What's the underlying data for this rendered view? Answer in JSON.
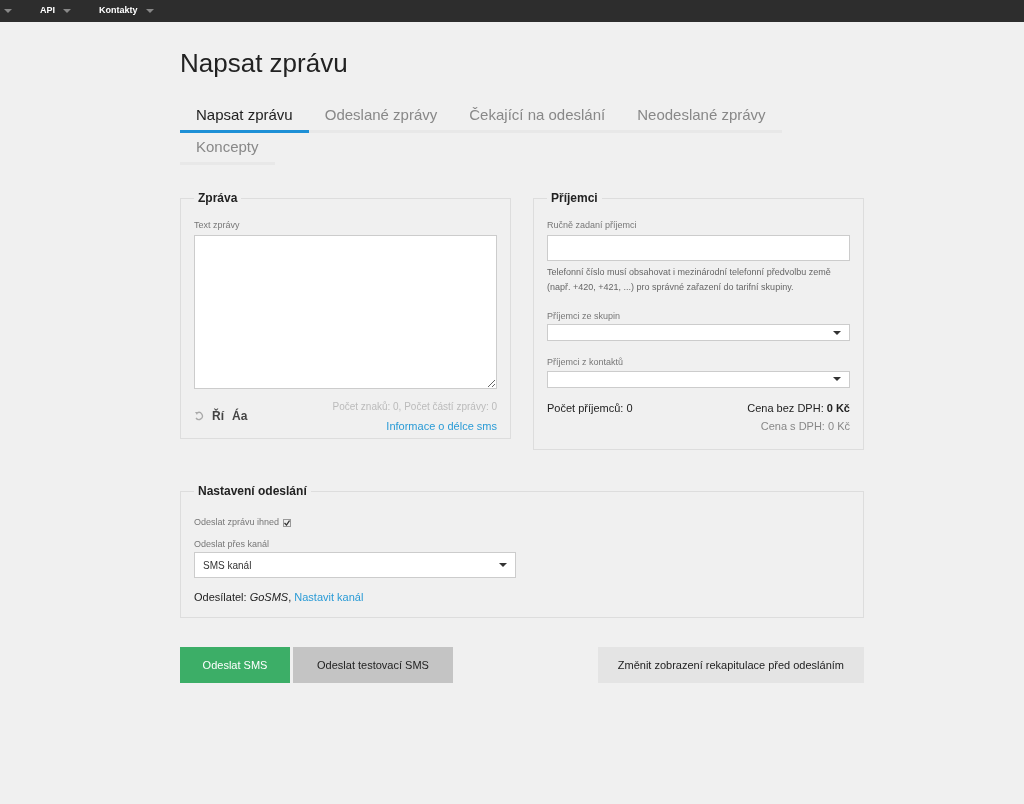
{
  "navbar": {
    "items": [
      {
        "label": "API"
      },
      {
        "label": "Kontakty"
      }
    ]
  },
  "page_title": "Napsat zprávu",
  "tabs": [
    {
      "label": "Napsat zprávu",
      "selected": true
    },
    {
      "label": "Odeslané zprávy",
      "selected": false
    },
    {
      "label": "Čekající na odeslání",
      "selected": false
    },
    {
      "label": "Neodeslané zprávy",
      "selected": false
    },
    {
      "label": "Koncepty",
      "selected": false
    }
  ],
  "message": {
    "legend": "Zpráva",
    "label": "Text zprávy",
    "toolbar": [
      "Ří",
      "Áa"
    ],
    "counter": "Počet znaků: 0, Počet částí zprávy: 0",
    "info_link": "Informace o délce sms"
  },
  "recipients": {
    "legend": "Příjemci",
    "manual_label": "Ručně zadaní příjemci",
    "hint": "Telefonní číslo musí obsahovat i mezinárodní telefonní předvolbu země (např. +420, +421, ...) pro správné zařazení do tarifní skupiny.",
    "groups_label": "Příjemci ze skupin",
    "contacts_label": "Příjemci z kontaktů",
    "count": "Počet příjemců: 0",
    "price_without_vat": "Cena bez DPH: **0 Kč**",
    "price_with_vat": "Cena s DPH: 0 Kč"
  },
  "settings": {
    "legend": "Nastavení odeslání",
    "send_now_label": "Odeslat zprávu ihned",
    "send_now_checked": true,
    "channel_label": "Odeslat přes kanál",
    "channel_value": "SMS kanál",
    "sender_prefix": "Odesílatel: ",
    "sender_name": "GoSMS",
    "sender_sep": ", ",
    "sender_link": "Nastavit kanál"
  },
  "buttons": [
    {
      "label": "Odeslat SMS",
      "kind": "primary"
    },
    {
      "label": "Odeslat testovací SMS",
      "kind": "secondary"
    },
    {
      "label": "Změnit zobrazení rekapitulace před odesláním",
      "kind": "light"
    }
  ]
}
